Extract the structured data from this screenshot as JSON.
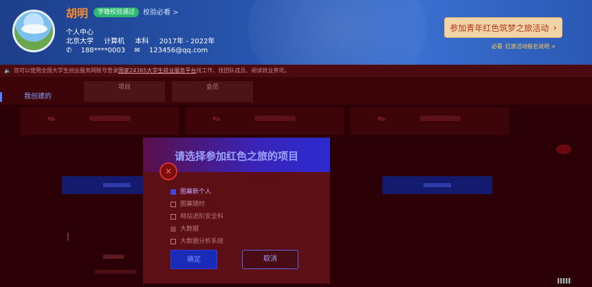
{
  "profile": {
    "name": "胡明",
    "verify_badge": "学籍校验通过",
    "must_see": "校验必看 >",
    "center": "个人中心",
    "school": "北京大学",
    "major": "计算机",
    "degree": "本科",
    "years": "2017年 - 2022年",
    "phone": "188****0003",
    "email": "123456@qq.com"
  },
  "campaign": {
    "button_label": "参加青年红色筑梦之旅活动",
    "note_prefix": "必看",
    "note_link": "红旅活动报名说明 >"
  },
  "notice": {
    "text_before": "您可以使用全国大学生创业服务网账号登录",
    "link": "国家24365大学生就业服务平台",
    "text_after": "找工作、找团队成员、阅读就业资讯。"
  },
  "tabs": {
    "my_created": "我创建的",
    "tab_project": "项目",
    "tab_team": "会员"
  },
  "modal": {
    "title": "请选择参加红色之旅的项目",
    "options": [
      {
        "label": "图幕新个人",
        "state": "checked"
      },
      {
        "label": "图幕随时",
        "state": "unchecked"
      },
      {
        "label": "网站进阶安全科",
        "state": "unchecked"
      },
      {
        "label": "大数据",
        "state": "partial"
      },
      {
        "label": "大数据分析系统",
        "state": "unchecked"
      }
    ],
    "ok_label": "确定",
    "cancel_label": "取消"
  },
  "colors": {
    "header_blue": "#2856b0",
    "overlay_red": "#2a0006",
    "modal_bg": "#5c0f14",
    "primary_button": "#1a2bb8"
  }
}
